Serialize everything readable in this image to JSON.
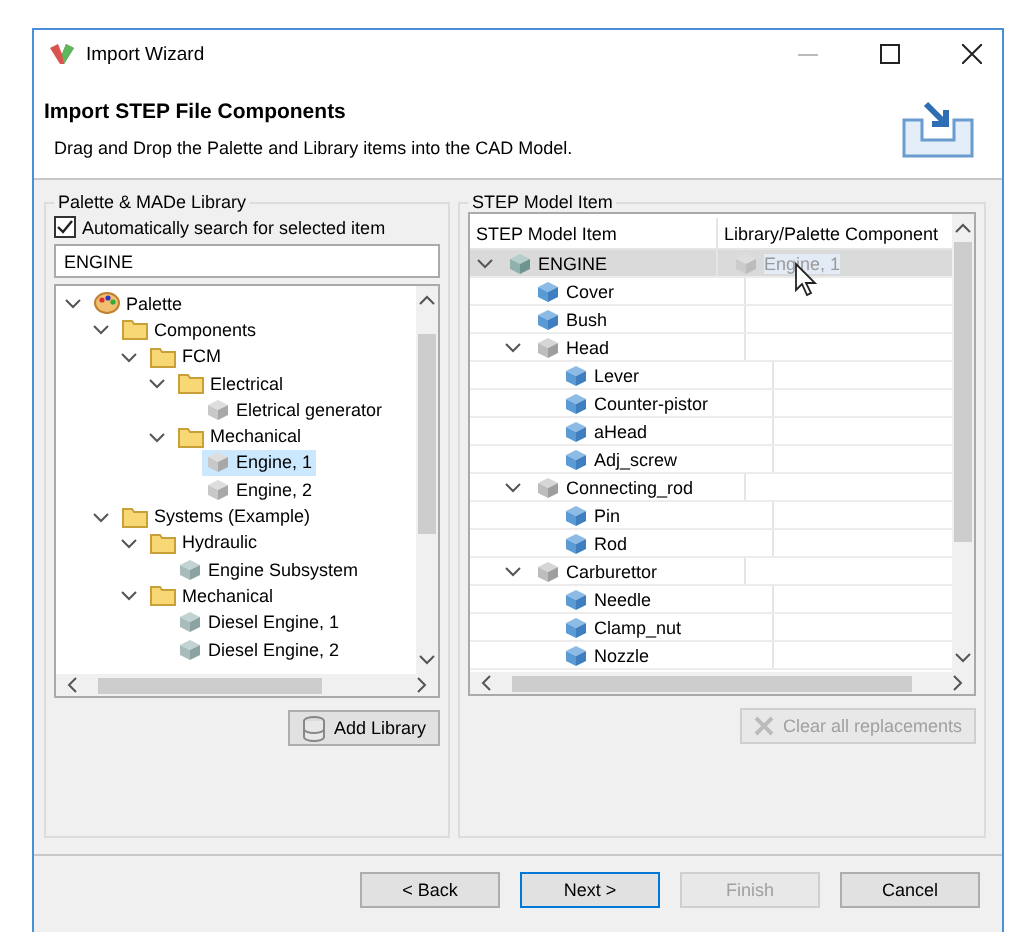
{
  "window": {
    "title": "Import Wizard"
  },
  "header": {
    "title": "Import STEP File Components",
    "description": "Drag and Drop the Palette and Library items into the CAD Model."
  },
  "library_panel": {
    "title": "Palette & MADe Library",
    "auto_search": {
      "label": "Automatically search for selected item",
      "checked": true
    },
    "search": {
      "value": "ENGINE"
    },
    "tree": [
      {
        "label": "Palette",
        "kind": "palette",
        "expanded": true,
        "selected": false,
        "children": [
          {
            "label": "Components",
            "kind": "folder",
            "expanded": true,
            "selected": false,
            "children": [
              {
                "label": "FCM",
                "kind": "folder",
                "expanded": true,
                "selected": false,
                "children": [
                  {
                    "label": "Electrical",
                    "kind": "folder",
                    "expanded": true,
                    "selected": false,
                    "children": [
                      {
                        "label": "Eletrical generator",
                        "kind": "component",
                        "selected": false
                      }
                    ]
                  },
                  {
                    "label": "Mechanical",
                    "kind": "folder",
                    "expanded": true,
                    "selected": false,
                    "children": [
                      {
                        "label": "Engine, 1",
                        "kind": "component",
                        "selected": true
                      },
                      {
                        "label": "Engine, 2",
                        "kind": "component",
                        "selected": false
                      }
                    ]
                  }
                ]
              }
            ]
          },
          {
            "label": "Systems (Example)",
            "kind": "folder",
            "expanded": true,
            "selected": false,
            "children": [
              {
                "label": "Hydraulic",
                "kind": "folder",
                "expanded": true,
                "selected": false,
                "children": [
                  {
                    "label": "Engine Subsystem",
                    "kind": "system",
                    "selected": false
                  }
                ]
              },
              {
                "label": "Mechanical",
                "kind": "folder",
                "expanded": true,
                "selected": false,
                "children": [
                  {
                    "label": "Diesel Engine, 1",
                    "kind": "system",
                    "selected": false
                  },
                  {
                    "label": "Diesel Engine, 2",
                    "kind": "system",
                    "selected": false
                  }
                ]
              }
            ]
          }
        ]
      }
    ],
    "add_button": {
      "label": "Add Library",
      "disabled": false
    }
  },
  "model_panel": {
    "title": "STEP Model Item",
    "columns": [
      "STEP Model Item",
      "Library/Palette Component"
    ],
    "tree": [
      {
        "label": "ENGINE",
        "kind": "root",
        "expanded": true,
        "selected": true,
        "replacement": "Engine, 1",
        "children": [
          {
            "label": "Cover",
            "kind": "part",
            "selected": false
          },
          {
            "label": "Bush",
            "kind": "part",
            "selected": false
          },
          {
            "label": "Head",
            "kind": "assembly",
            "expanded": true,
            "selected": false,
            "children": [
              {
                "label": "Lever",
                "kind": "part",
                "selected": false
              },
              {
                "label": "Counter-pistor",
                "kind": "part",
                "selected": false
              },
              {
                "label": "aHead",
                "kind": "part",
                "selected": false
              },
              {
                "label": "Adj_screw",
                "kind": "part",
                "selected": false
              }
            ]
          },
          {
            "label": "Connecting_rod",
            "kind": "assembly",
            "expanded": true,
            "selected": false,
            "children": [
              {
                "label": "Pin",
                "kind": "part",
                "selected": false
              },
              {
                "label": "Rod",
                "kind": "part",
                "selected": false
              }
            ]
          },
          {
            "label": "Carburettor",
            "kind": "assembly",
            "expanded": true,
            "selected": false,
            "children": [
              {
                "label": "Needle",
                "kind": "part",
                "selected": false
              },
              {
                "label": "Clamp_nut",
                "kind": "part",
                "selected": false
              },
              {
                "label": "Nozzle",
                "kind": "part",
                "selected": false
              }
            ]
          }
        ]
      }
    ],
    "clear_button": {
      "label": "Clear all replacements",
      "disabled": true
    }
  },
  "buttons": [
    {
      "label": "< Back",
      "disabled": false,
      "default": false
    },
    {
      "label": "Next >",
      "disabled": false,
      "default": true
    },
    {
      "label": "Finish",
      "disabled": true,
      "default": false
    },
    {
      "label": "Cancel",
      "disabled": false,
      "default": false
    }
  ]
}
